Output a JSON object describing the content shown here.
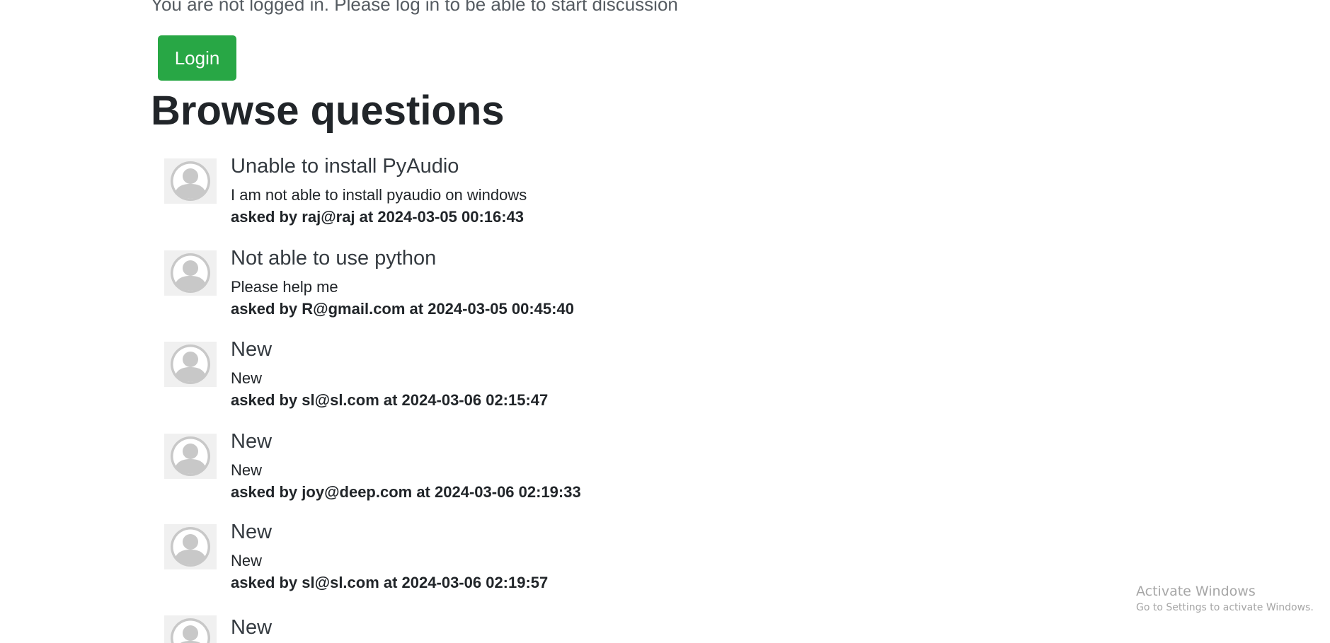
{
  "notice": "You are not logged in. Please log in to be able to start discussion",
  "login_label": "Login",
  "heading": "Browse questions",
  "questions": [
    {
      "title": "Unable to install PyAudio",
      "desc": "I am not able to install pyaudio on windows",
      "meta": "asked by raj@raj at 2024-03-05 00:16:43",
      "avatar_icon": "user-avatar-icon"
    },
    {
      "title": "Not able to use python",
      "desc": "Please help me",
      "meta": "asked by R@gmail.com at 2024-03-05 00:45:40",
      "avatar_icon": "user-avatar-icon"
    },
    {
      "title": "New",
      "desc": "New",
      "meta": "asked by sl@sl.com at 2024-03-06 02:15:47",
      "avatar_icon": "user-avatar-icon"
    },
    {
      "title": "New",
      "desc": "New",
      "meta": "asked by joy@deep.com at 2024-03-06 02:19:33",
      "avatar_icon": "user-avatar-icon"
    },
    {
      "title": "New",
      "desc": "New",
      "meta": "asked by sl@sl.com at 2024-03-06 02:19:57",
      "avatar_icon": "user-avatar-icon"
    },
    {
      "title": "New",
      "desc": "",
      "meta": "",
      "avatar_icon": "user-avatar-icon"
    }
  ],
  "watermark": {
    "title": "Activate Windows",
    "subtitle": "Go to Settings to activate Windows."
  },
  "colors": {
    "login_button": "#28a745",
    "avatar_bg": "#f0f0f0",
    "avatar_fg": "#c8c8c8"
  }
}
